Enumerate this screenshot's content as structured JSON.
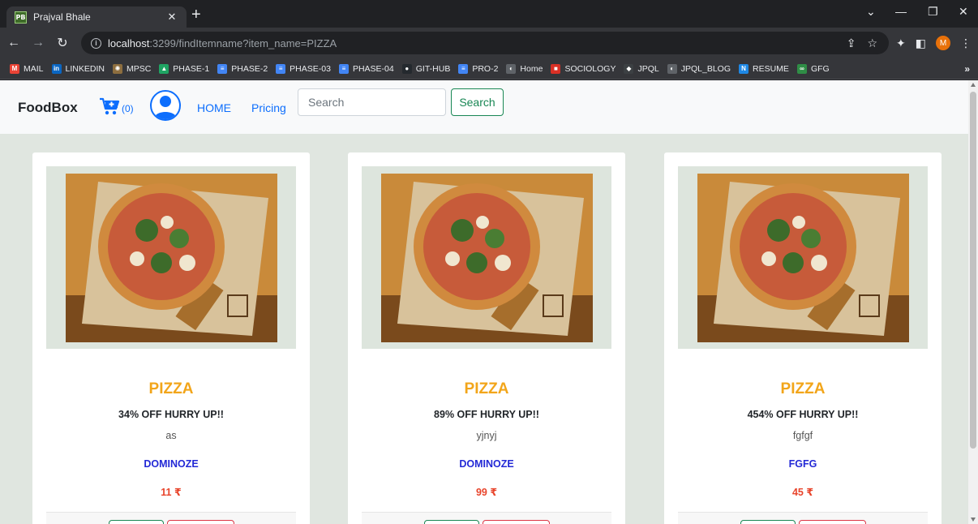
{
  "browser": {
    "tab": {
      "favicon_text": "PB",
      "title": "Prajval Bhale"
    },
    "address": {
      "host": "localhost",
      "rest": ":3299/findItemname?item_name=PIZZA"
    },
    "profile_initial": "M",
    "bookmarks": [
      {
        "label": "MAIL",
        "icon": "gmail-icon",
        "color": "#ea4335",
        "glyph": "M"
      },
      {
        "label": "LINKEDIN",
        "icon": "linkedin-icon",
        "color": "#0a66c2",
        "glyph": "in"
      },
      {
        "label": "MPSC",
        "icon": "emblem-icon",
        "color": "#8d6e3f",
        "glyph": "✺"
      },
      {
        "label": "PHASE-1",
        "icon": "drive-icon",
        "color": "#1fa463",
        "glyph": "▲"
      },
      {
        "label": "PHASE-2",
        "icon": "docs-icon",
        "color": "#4285f4",
        "glyph": "≡"
      },
      {
        "label": "PHASE-03",
        "icon": "docs-icon",
        "color": "#4285f4",
        "glyph": "≡"
      },
      {
        "label": "PHASE-04",
        "icon": "docs-icon",
        "color": "#4285f4",
        "glyph": "≡"
      },
      {
        "label": "GIT-HUB",
        "icon": "github-icon",
        "color": "#24292e",
        "glyph": "●"
      },
      {
        "label": "PRO-2",
        "icon": "docs-icon",
        "color": "#4285f4",
        "glyph": "≡"
      },
      {
        "label": "Home",
        "icon": "globe-icon",
        "color": "#5f6368",
        "glyph": "◐"
      },
      {
        "label": "SOCIOLOGY",
        "icon": "sociology-icon",
        "color": "#d93025",
        "glyph": "■"
      },
      {
        "label": "JPQL",
        "icon": "jpql-icon",
        "color": "#3c4043",
        "glyph": "◆"
      },
      {
        "label": "JPQL_BLOG",
        "icon": "globe-icon",
        "color": "#5f6368",
        "glyph": "◐"
      },
      {
        "label": "RESUME",
        "icon": "resume-icon",
        "color": "#1e88e5",
        "glyph": "N"
      },
      {
        "label": "GFG",
        "icon": "gfg-icon",
        "color": "#2f8d46",
        "glyph": "∞"
      }
    ]
  },
  "site": {
    "brand": "FoodBox",
    "cart_count": "(0)",
    "nav_home": "HOME",
    "nav_pricing": "Pricing",
    "search_placeholder": "Search",
    "search_button": "Search"
  },
  "cards": [
    {
      "title": "PIZZA",
      "offer": "34% OFF HURRY UP!!",
      "desc": "as",
      "brand": "DOMINOZE",
      "price": "11 ₹"
    },
    {
      "title": "PIZZA",
      "offer": "89% OFF HURRY UP!!",
      "desc": "yjnyj",
      "brand": "DOMINOZE",
      "price": "99 ₹"
    },
    {
      "title": "PIZZA",
      "offer": "454% OFF HURRY UP!!",
      "desc": "fgfgf",
      "brand": "FGFG",
      "price": "45 ₹"
    }
  ]
}
